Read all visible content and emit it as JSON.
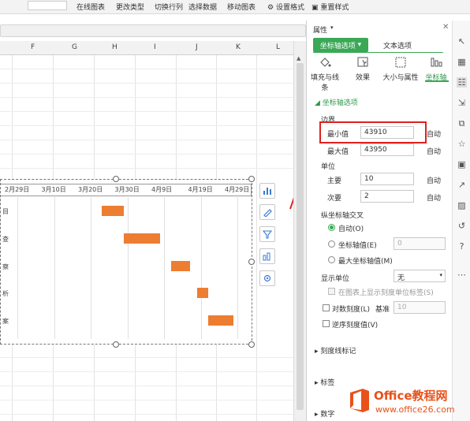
{
  "ribbon": {
    "items": [
      "在线图表",
      "更改类型",
      "切换行列",
      "选择数据",
      "移动图表",
      "设置格式",
      "重置样式"
    ]
  },
  "columns": [
    "F",
    "G",
    "H",
    "I",
    "J",
    "K",
    "L"
  ],
  "chart": {
    "x_ticks": [
      "2月29日",
      "3月10日",
      "3月20日",
      "3月30日",
      "4月9日",
      "4月19日",
      "4月29日"
    ],
    "categories": [
      "项目",
      "调查",
      "考察",
      "分析",
      "方案"
    ]
  },
  "chart_data": {
    "type": "bar",
    "orientation": "horizontal",
    "categories": [
      "项目",
      "调查",
      "考察",
      "分析",
      "方案"
    ],
    "x_axis_ticks": [
      "2月29日",
      "3月10日",
      "3月20日",
      "3月30日",
      "4月9日",
      "4月19日",
      "4月29日"
    ],
    "series": [
      {
        "name": "",
        "start": [
          "3月23日",
          "3月29日",
          "4月11日",
          "4月18日",
          "4月21日"
        ],
        "duration_days": [
          6,
          10,
          5,
          3,
          7
        ],
        "color": "#ED7D31"
      }
    ]
  },
  "panel": {
    "title": "属性",
    "tab_active": "坐标轴选项",
    "tab_other": "文本选项",
    "subtabs": [
      "填充与线条",
      "效果",
      "大小与属性",
      "坐标轴"
    ],
    "section": "坐标轴选项",
    "bounds_label": "边界",
    "min_label": "最小值",
    "min_value": "43910",
    "max_label": "最大值",
    "max_value": "43950",
    "auto": "自动",
    "units_label": "单位",
    "major_label": "主要",
    "major_value": "10",
    "minor_label": "次要",
    "minor_value": "2",
    "cross_label": "纵坐标轴交叉",
    "cross_auto": "自动(O)",
    "cross_value": "坐标轴值(E)",
    "cross_value_input": "0",
    "cross_max": "最大坐标轴值(M)",
    "display_unit_label": "显示单位",
    "display_unit_value": "无",
    "show_unit_label": "在图表上显示刻度单位标签(S)",
    "log_label": "对数刻度(L)",
    "base_label": "基准",
    "base_value": "10",
    "reverse_label": "逆序刻度值(V)",
    "tick_marks": "刻度线标记",
    "labels": "标签",
    "number": "数字"
  },
  "watermark": {
    "brand": "Office教程网",
    "url": "www.office26.com"
  },
  "colors": {
    "bar": "#ED7D31",
    "accent_green": "#2f9a4b",
    "highlight": "#e02020"
  }
}
